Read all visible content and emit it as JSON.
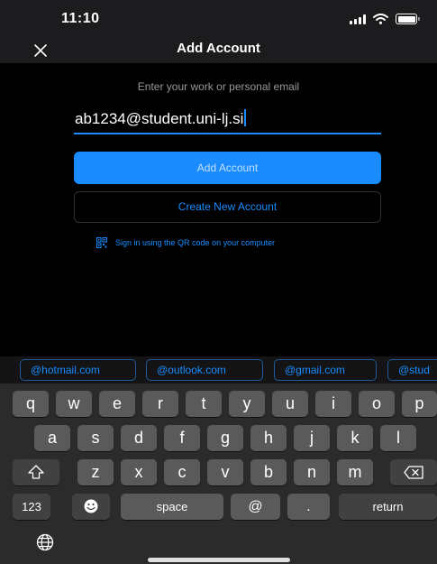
{
  "status_bar": {
    "time": "11:10",
    "icons": [
      "signal-icon",
      "wifi-icon",
      "battery-icon"
    ]
  },
  "nav": {
    "title": "Add Account",
    "close_icon": "close-icon"
  },
  "form": {
    "instruction": "Enter your work or personal email",
    "email_value": "ab1234@student.uni-lj.si",
    "add_account_label": "Add Account",
    "create_account_label": "Create New Account",
    "qr_label": "Sign in using the QR code on your computer"
  },
  "suggestions": [
    "@hotmail.com",
    "@outlook.com",
    "@gmail.com",
    "@stud"
  ],
  "keyboard": {
    "row1": [
      "q",
      "w",
      "e",
      "r",
      "t",
      "y",
      "u",
      "i",
      "o",
      "p"
    ],
    "row2": [
      "a",
      "s",
      "d",
      "f",
      "g",
      "h",
      "j",
      "k",
      "l"
    ],
    "row3": [
      "z",
      "x",
      "c",
      "v",
      "b",
      "n",
      "m"
    ],
    "numbers_label": "123",
    "space_label": "space",
    "at_label": "@",
    "dot_label": ".",
    "return_label": "return"
  },
  "colors": {
    "accent": "#1a8cff",
    "background": "#000000",
    "keyboard": "#2b2b2b",
    "key": "#5a5a5a"
  }
}
